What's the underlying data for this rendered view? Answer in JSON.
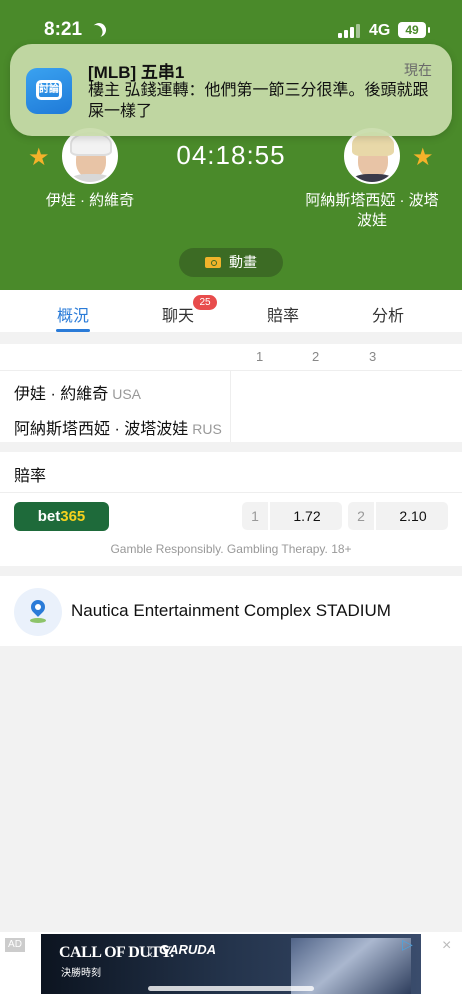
{
  "status_bar": {
    "time": "8:21",
    "network": "4G",
    "battery": "49"
  },
  "notification": {
    "title": "[MLB] 五串1",
    "time": "現在",
    "body": "樓主 弘錢運轉：他們第一節三分很準。後頭就跟屎一樣了",
    "icon": "forum-app-icon"
  },
  "match": {
    "clock": "04:18:55",
    "home_name": "伊娃 · 約維奇",
    "away_name": "阿納斯塔西婭 · 波塔波娃",
    "animation_label": "動畫"
  },
  "tabs": [
    {
      "label": "概況",
      "active": true
    },
    {
      "label": "聊天",
      "badge": "25"
    },
    {
      "label": "賠率"
    },
    {
      "label": "分析"
    }
  ],
  "scoreboard": {
    "set_headers": [
      "1",
      "2",
      "3"
    ],
    "rows": [
      {
        "name": "伊娃 · 約維奇",
        "country": "USA"
      },
      {
        "name": "阿納斯塔西婭 · 波塔波娃",
        "country": "RUS"
      }
    ]
  },
  "odds": {
    "title": "賠率",
    "bookmaker_main": "bet",
    "bookmaker_highlight": "365",
    "options": [
      {
        "key": "1",
        "value": "1.72"
      },
      {
        "key": "2",
        "value": "2.10"
      }
    ],
    "disclaimer": "Gamble Responsibly. Gambling Therapy. 18+"
  },
  "venue": {
    "name": "Nautica Entertainment Complex STADIUM"
  },
  "ad": {
    "label": "AD",
    "brand": "CALL OF DUTY.",
    "sub": "決勝時刻",
    "collab": "GARUDA",
    "x": "×",
    "close": "×"
  },
  "colors": {
    "hero": "#4a8a2a",
    "accent": "#2a7bd8",
    "badge": "#e84c4c",
    "star": "#f5b22a"
  }
}
